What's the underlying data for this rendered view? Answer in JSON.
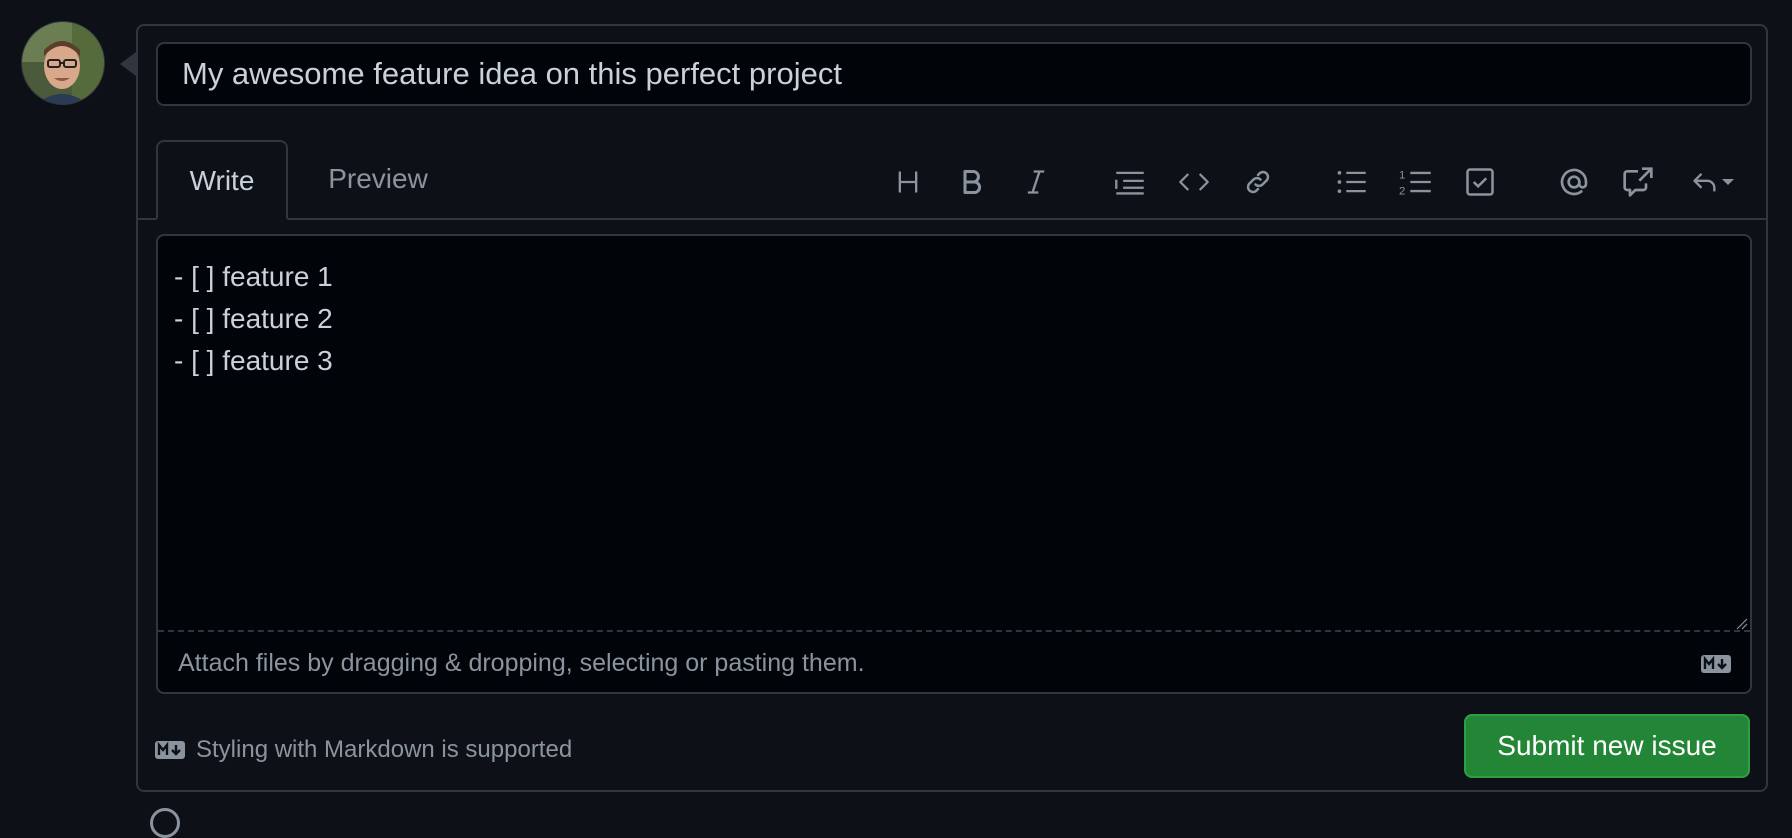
{
  "avatar": {
    "alt": "User avatar"
  },
  "issue": {
    "title_value": "My awesome feature idea on this perfect project"
  },
  "tabs": {
    "write": "Write",
    "preview": "Preview",
    "active": "write"
  },
  "toolbar": {
    "buttons": [
      {
        "name": "heading-icon"
      },
      {
        "name": "bold-icon"
      },
      {
        "name": "italic-icon"
      },
      {
        "name": "quote-icon"
      },
      {
        "name": "code-icon"
      },
      {
        "name": "link-icon"
      },
      {
        "name": "unordered-list-icon"
      },
      {
        "name": "ordered-list-icon"
      },
      {
        "name": "task-list-icon"
      },
      {
        "name": "mention-icon"
      },
      {
        "name": "cross-reference-icon"
      },
      {
        "name": "reply-icon"
      }
    ]
  },
  "editor": {
    "lines": [
      "- [ ] feature 1",
      "- [ ] feature 2",
      "- [ ] feature 3"
    ],
    "attach_hint": "Attach files by dragging & dropping, selecting or pasting them."
  },
  "footer": {
    "markdown_note": "Styling with Markdown is supported",
    "submit_label": "Submit new issue"
  },
  "colors": {
    "background": "#0d1117",
    "border": "#30363d",
    "text": "#c9d1d9",
    "muted": "#8b949e",
    "submit": "#238636"
  }
}
